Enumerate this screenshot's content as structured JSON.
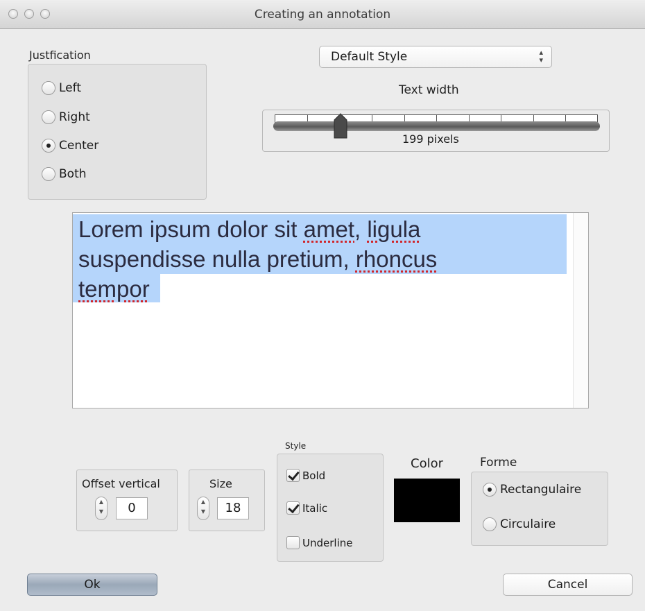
{
  "window": {
    "title": "Creating an annotation"
  },
  "justification": {
    "label": "Justfication",
    "options": [
      "Left",
      "Right",
      "Center",
      "Both"
    ],
    "selected": "Center"
  },
  "style_select": {
    "value": "Default Style"
  },
  "text_width": {
    "label": "Text width",
    "value": 199,
    "readout": "199  pixels"
  },
  "editor": {
    "lines": [
      [
        "Lorem ipsum dolor sit ",
        "amet",
        ", ",
        "ligula"
      ],
      [
        "suspendisse nulla pretium, ",
        "rhoncus"
      ],
      [
        "tempor"
      ]
    ]
  },
  "offset_vertical": {
    "label": "Offset vertical",
    "value": "0"
  },
  "size": {
    "label": "Size",
    "value": "18"
  },
  "style": {
    "label": "Style",
    "bold": {
      "label": "Bold",
      "checked": true
    },
    "italic": {
      "label": "Italic",
      "checked": true
    },
    "underline": {
      "label": "Underline",
      "checked": false
    }
  },
  "color": {
    "label": "Color",
    "value": "#000000"
  },
  "forme": {
    "label": "Forme",
    "options": [
      "Rectangulaire",
      "Circulaire"
    ],
    "selected": "Rectangulaire"
  },
  "buttons": {
    "ok": "Ok",
    "cancel": "Cancel"
  }
}
